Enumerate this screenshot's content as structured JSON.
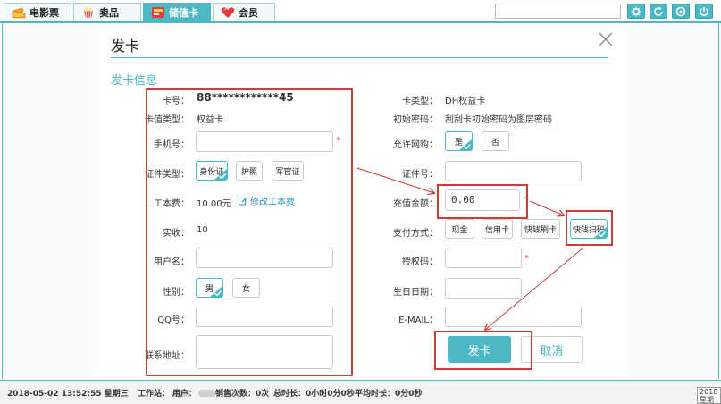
{
  "top_tabs": [
    {
      "label": "电影票",
      "icon": "ticket-icon"
    },
    {
      "label": "卖品",
      "icon": "popcorn-icon"
    },
    {
      "label": "储值卡",
      "icon": "card-icon",
      "active": true
    },
    {
      "label": "会员",
      "icon": "heart-icon"
    }
  ],
  "dialog": {
    "title": "发卡",
    "section_title": "发卡信息",
    "left": {
      "card_no_label": "卡号：",
      "card_no_value": "88************45",
      "card_type_label": "卡值类型：",
      "card_type_value": "权益卡",
      "phone_label": "手机号：",
      "phone_value": "",
      "phone_required": "*",
      "id_type_label": "证件类型：",
      "id_types": [
        "身份证",
        "护照",
        "军官证"
      ],
      "id_type_selected": "身份证",
      "fee_label": "工本费：",
      "fee_value": "10.00元",
      "fee_edit_link": "修改工本费",
      "actual_label": "实收：",
      "actual_value": "10",
      "username_label": "用户名：",
      "username_value": "",
      "gender_label": "性别：",
      "genders": [
        "男",
        "女"
      ],
      "gender_selected": "男",
      "qq_label": "QQ号：",
      "qq_value": "",
      "address_label": "联系地址：",
      "address_value": ""
    },
    "right": {
      "card_kind_label": "卡类型：",
      "card_kind_value": "DH权益卡",
      "init_pwd_label": "初始密码：",
      "init_pwd_value": "刮刮卡初始密码为图层密码",
      "online_label": "允许网购：",
      "online_options": [
        "是",
        "否"
      ],
      "online_selected": "是",
      "id_no_label": "证件号：",
      "id_no_value": "",
      "recharge_label": "充值金额：",
      "recharge_value": "0.00",
      "recharge_required": "*",
      "pay_label": "支付方式：",
      "pay_methods": [
        "现金",
        "信用卡",
        "快钱刷卡",
        "快钱扫码"
      ],
      "pay_selected": "快钱扫码",
      "auth_label": "授权码：",
      "auth_value": "",
      "auth_required": "*",
      "birthday_label": "生日日期：",
      "birthday_value": "",
      "email_label": "E-MAIL：",
      "email_value": ""
    },
    "submit_label": "发卡",
    "cancel_label": "取消"
  },
  "status_bar": {
    "datetime": "2018-05-02 13:52:55 星期三",
    "workstation_label": "工作站：",
    "user_label": "用户：",
    "sales_count": "销售次数：0次",
    "total_time": "总时长：0小时0分0秒",
    "avg_time": "平均时长：0分0秒"
  },
  "corner_widget": {
    "line1": "2018",
    "line2": "星期三"
  },
  "colors": {
    "accent": "#4cb8c4",
    "highlight": "#d13a3a"
  }
}
